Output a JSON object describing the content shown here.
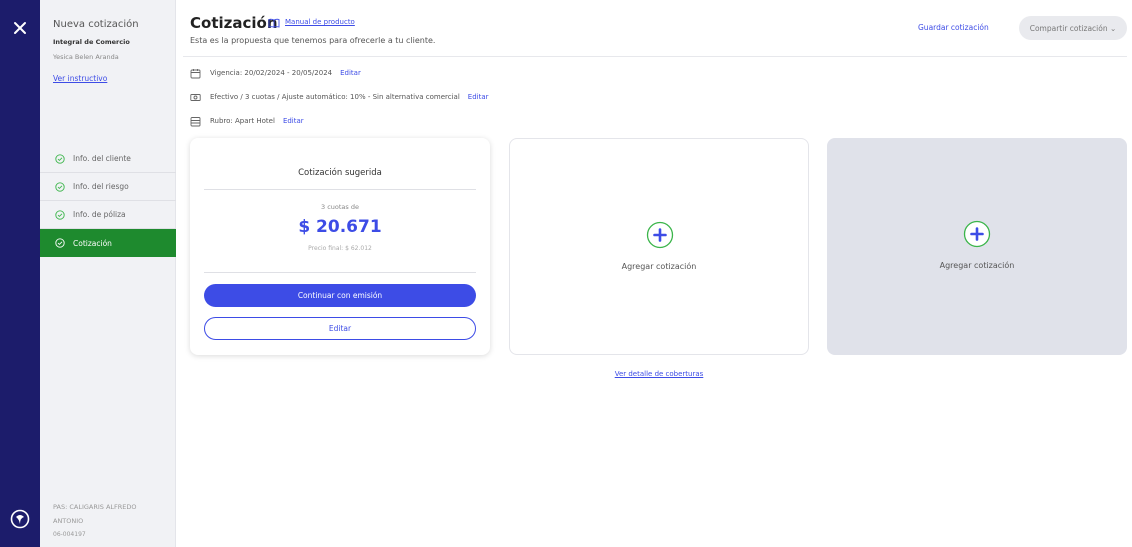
{
  "side": {
    "title": "Nueva cotización",
    "product": "Integral de Comercio",
    "user": "Yesica Belen Aranda",
    "instructivo_link": "Ver instructivo",
    "steps": [
      {
        "label": "Info. del cliente",
        "active": false
      },
      {
        "label": "Info. del riesgo",
        "active": false
      },
      {
        "label": "Info. de póliza",
        "active": false
      },
      {
        "label": "Cotización",
        "active": true
      }
    ],
    "pas_line1": "PAS: CALIGARIS ALFREDO",
    "pas_line2": "ANTONIO",
    "pas_code": "06-004197"
  },
  "header": {
    "title": "Cotización",
    "manual_link": "Manual de producto",
    "subtitle": "Esta es la propuesta que tenemos para ofrecerle a tu cliente.",
    "save_label": "Guardar cotización",
    "share_label": "Compartir cotización ⌄"
  },
  "info": {
    "vigencia": "Vigencia: 20/02/2024 - 20/05/2024",
    "payment": "Efectivo / 3 cuotas / Ajuste automático: 10% - Sin alternativa comercial",
    "rubro": "Rubro: Apart Hotel",
    "edit_label": "Editar"
  },
  "suggested": {
    "title": "Cotización sugerida",
    "installments": "3 cuotas de",
    "amount": "$ 20.671",
    "final_price": "Precio final: $ 62.012",
    "primary_button": "Continuar con emisión",
    "secondary_button": "Editar"
  },
  "add_card": {
    "label": "Agregar cotización"
  },
  "detail_link": "Ver detalle de coberturas",
  "colors": {
    "rail": "#1c1c6b",
    "accent": "#3d4ce6",
    "active_step": "#1e8a2e",
    "plus_ring": "#3bb54a"
  }
}
